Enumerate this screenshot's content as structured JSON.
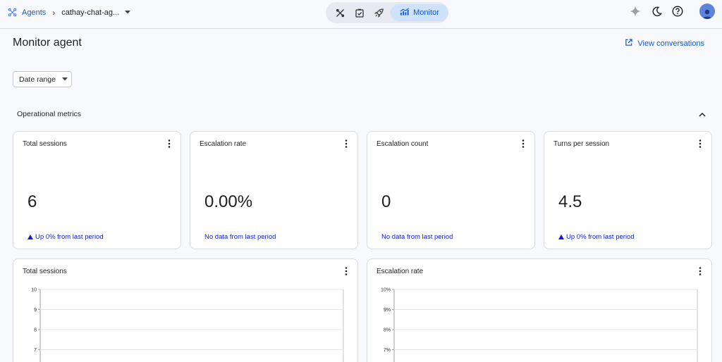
{
  "breadcrumb": {
    "root": "Agents",
    "current": "cathay-chat-ag..."
  },
  "nav": {
    "active_label": "Monitor",
    "icons": [
      "tools-icon",
      "task-check-icon",
      "rocket-icon"
    ]
  },
  "page": {
    "title": "Monitor agent",
    "view_conversations": "View conversations",
    "date_range": "Date range"
  },
  "section": {
    "title": "Operational metrics"
  },
  "metrics": [
    {
      "title": "Total sessions",
      "value": "6",
      "note": "Up 0% from last period",
      "trend": "up"
    },
    {
      "title": "Escalation rate",
      "value": "0.00%",
      "note": "No data from last period",
      "trend": "none"
    },
    {
      "title": "Escalation count",
      "value": "0",
      "note": "No data from last period",
      "trend": "none"
    },
    {
      "title": "Turns per session",
      "value": "4.5",
      "note": "Up 0% from last period",
      "trend": "up"
    }
  ],
  "charts": [
    {
      "title": "Total sessions"
    },
    {
      "title": "Escalation rate"
    }
  ],
  "chart_data": [
    {
      "type": "line",
      "title": "Total sessions",
      "y_ticks": [
        "10",
        "9",
        "8",
        "7"
      ],
      "grid": true,
      "series": []
    },
    {
      "type": "line",
      "title": "Escalation rate",
      "y_ticks": [
        "10%",
        "9%",
        "8%",
        "7%"
      ],
      "grid": true,
      "series": []
    }
  ],
  "colors": {
    "accent": "#0b57d0",
    "active_pill": "#cfe2fb",
    "trend": "#0b1fd0"
  }
}
